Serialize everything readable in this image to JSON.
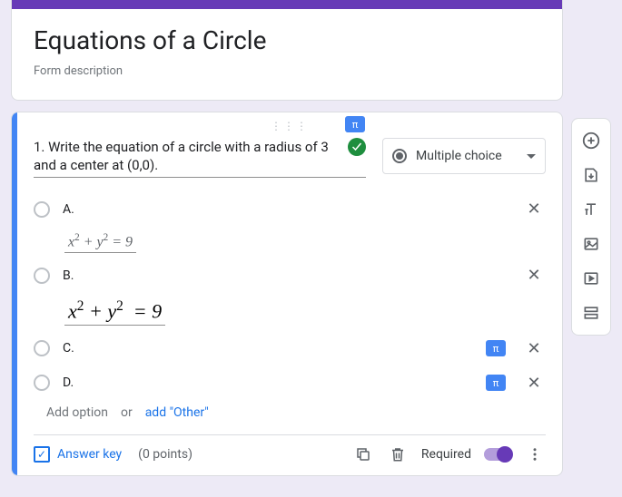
{
  "header": {
    "title": "Equations of a Circle",
    "description": "Form description"
  },
  "question": {
    "text": "1. Write the equation of a circle with a radius of 3 and a center at (0,0).",
    "type_label": "Multiple choice",
    "options": {
      "a": "A.",
      "b": "B.",
      "c": "C.",
      "d": "D."
    },
    "equation_a": "x² + y² = 9",
    "equation_b": "x² + y²  = 9",
    "add_option": "Add option",
    "or": "or",
    "add_other": "add \"Other\""
  },
  "footer": {
    "answer_key": "Answer key",
    "points": "(0 points)",
    "required": "Required"
  }
}
